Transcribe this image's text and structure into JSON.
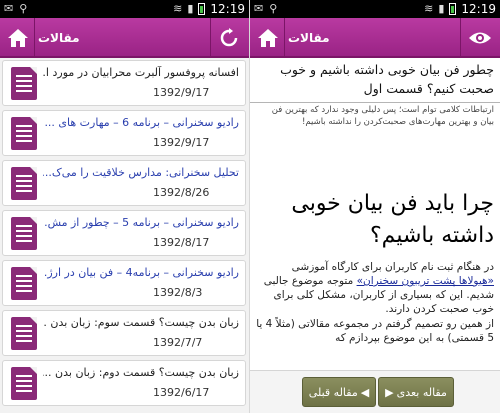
{
  "status": {
    "time": "12:19",
    "icons": [
      "notification-icon",
      "wifi-icon",
      "signal-icon",
      "battery-icon"
    ]
  },
  "left_screen": {
    "header_title": "مقالات",
    "list_items": [
      {
        "title": "افسانه پروفسور آلبرت محرابیان در مورد ا...",
        "date": "1392/9/17",
        "link": false
      },
      {
        "title": "رادیو سخنرانی – برنامه 6 – مهارت های ...",
        "date": "1392/9/17",
        "link": true
      },
      {
        "title": "تحلیل سخنرانی: مدارس خلاقیت را می‌ک...",
        "date": "1392/8/26",
        "link": true
      },
      {
        "title": "رادیو سخنرانی – برنامه 5 – چطور از مش...",
        "date": "1392/8/17",
        "link": true
      },
      {
        "title": "رادیو سخنرانی – برنامه4 – فن بیان در ارژ...",
        "date": "1392/8/3",
        "link": true
      },
      {
        "title": "زبان بدن چیست؟ قسمت سوم: زبان بدن ...",
        "date": "1392/7/7",
        "link": false
      },
      {
        "title": "زبان بدن چیست؟ قسمت دوم: زبان بدن ...",
        "date": "1392/6/17",
        "link": false
      }
    ]
  },
  "right_screen": {
    "header_title": "مقالات",
    "article_title": "چطور فن بیان خوبی داشته باشیم و خوب صحبت کنیم؟ قسمت اول",
    "faded_text": "ارتباطات کلامی توام است؛ پس دلیلی وجود ندارد که بهترین فن بیان و بهترین مهارت‌های صحبت‌کردن را نداشته باشیم!",
    "big_heading": "چرا باید فن بیان خوبی داشته باشیم؟",
    "para1_before": "در هنگام ثبت نام کاربران برای کارگاه آموزشی ",
    "para1_link": "«هیولاها پشت تریبون سخنران»",
    "para1_after": " متوجه موضوع جالبی شدیم. این که بسیاری از کاربران، مشکل کلی برای خوب صحبت کردن دارند.",
    "para2": "از همین رو تصمیم گرفتم در مجموعه مقالاتی (مثلاً 4 یا 5 قسمتی) به این موضوع بپردازم که",
    "btn_prev": "مقاله قبلی",
    "btn_next": "مقاله بعدی"
  },
  "colors": {
    "header": "#a92a91",
    "doc_icon": "#8a2a78",
    "link_text": "#2a3fae",
    "nav_button": "#7d8152"
  }
}
